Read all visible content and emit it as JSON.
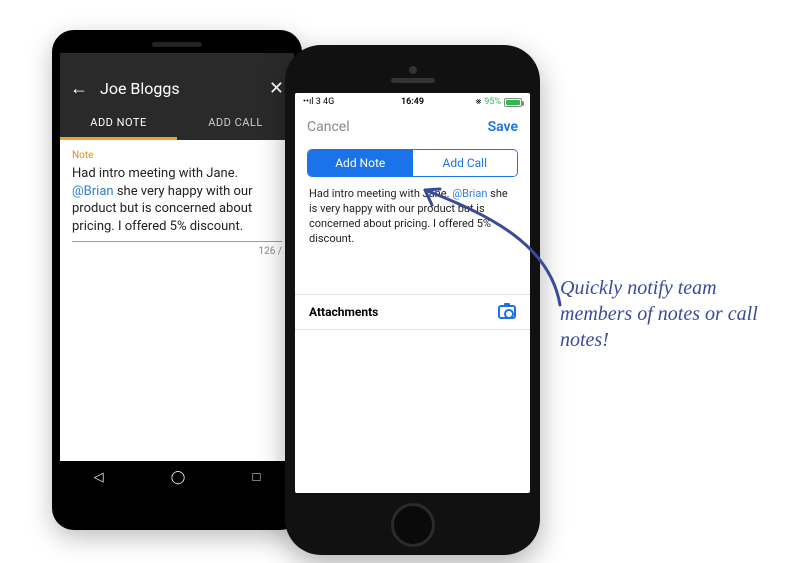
{
  "android": {
    "contact_name": "Joe Bloggs",
    "tabs": {
      "add_note": "ADD NOTE",
      "add_call": "ADD CALL"
    },
    "note_label": "Note",
    "note_before": "Had intro meeting with Jane. ",
    "note_mention": "@Brian",
    "note_after": " she very happy with our product but is concerned about pricing. I offered 5% discount.",
    "char_count": "126 /"
  },
  "ios": {
    "status": {
      "carrier": "3  4G",
      "signal": "••ıl",
      "time": "16:49",
      "battery_pct": "95%"
    },
    "nav": {
      "cancel": "Cancel",
      "save": "Save"
    },
    "segmented": {
      "add_note": "Add Note",
      "add_call": "Add Call"
    },
    "note_before": "Had intro meeting with Jane. ",
    "note_mention": "@Brian",
    "note_after": " she is very happy with our product but is concerned about pricing. I offered 5% discount.",
    "attachments_label": "Attachments"
  },
  "annotation": "Quickly notify team members of notes or call notes!"
}
